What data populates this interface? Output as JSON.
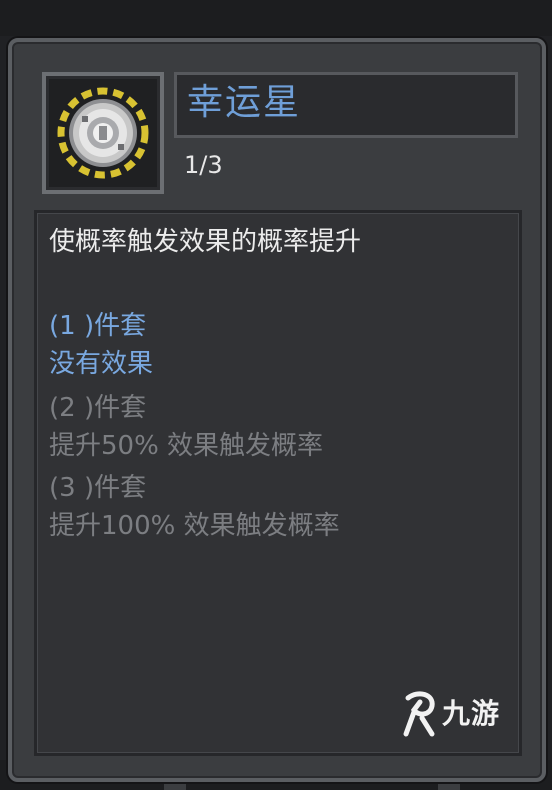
{
  "item": {
    "name": "幸运星",
    "count": "1/3"
  },
  "description": {
    "summary": "使概率触发效果的概率提升",
    "tiers": [
      {
        "label": "(1 )件套",
        "effect": "没有效果"
      },
      {
        "label": "(2 )件套",
        "effect": "提升50% 效果触发概率"
      },
      {
        "label": "(3 )件套",
        "effect": "提升100% 效果触发概率"
      }
    ]
  },
  "watermark": {
    "text": "九游",
    "icon": "jiuyou-logo-icon"
  },
  "colors": {
    "title": "#6f9fd8",
    "active_tier": "#79a8e0",
    "inactive_tier": "#7c7e82",
    "summary": "#ececec",
    "icon_gold": "#d8c232",
    "icon_silver": "#c8c8c8"
  }
}
